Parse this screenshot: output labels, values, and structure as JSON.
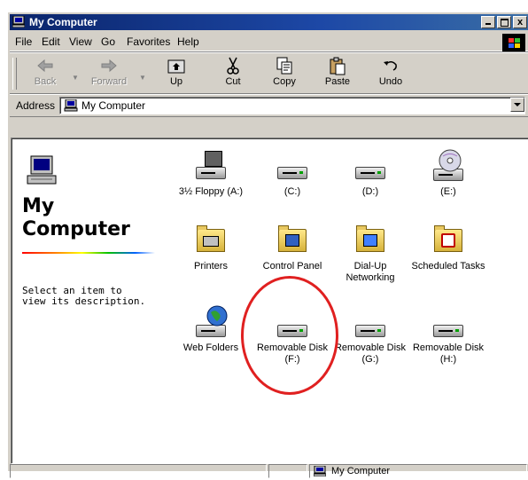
{
  "window": {
    "title": "My Computer",
    "close_glyph": "x"
  },
  "menu": {
    "items": [
      {
        "label": "File"
      },
      {
        "label": "Edit"
      },
      {
        "label": "View"
      },
      {
        "label": "Go"
      },
      {
        "label": "Favorites"
      },
      {
        "label": "Help"
      }
    ]
  },
  "toolbar": {
    "back": "Back",
    "forward": "Forward",
    "up": "Up",
    "cut": "Cut",
    "copy": "Copy",
    "paste": "Paste",
    "undo": "Undo"
  },
  "address": {
    "label": "Address",
    "value": "My Computer"
  },
  "left_panel": {
    "title_line1": "My",
    "title_line2": "Computer",
    "description": "Select an item to view its description."
  },
  "items": [
    {
      "label": "3½ Floppy (A:)",
      "icon": "floppy-drive-icon"
    },
    {
      "label": "(C:)",
      "icon": "hard-drive-icon"
    },
    {
      "label": "(D:)",
      "icon": "hard-drive-icon"
    },
    {
      "label": "(E:)",
      "icon": "cd-drive-icon"
    },
    {
      "label": "Printers",
      "icon": "printers-folder-icon"
    },
    {
      "label": "Control Panel",
      "icon": "control-panel-folder-icon"
    },
    {
      "label": "Dial-Up Networking",
      "icon": "dialup-folder-icon"
    },
    {
      "label": "Scheduled Tasks",
      "icon": "scheduled-tasks-folder-icon"
    },
    {
      "label": "Web Folders",
      "icon": "web-folders-icon"
    },
    {
      "label": "Removable Disk (F:)",
      "icon": "removable-disk-icon"
    },
    {
      "label": "Removable Disk (G:)",
      "icon": "removable-disk-icon"
    },
    {
      "label": "Removable Disk (H:)",
      "icon": "removable-disk-icon"
    }
  ],
  "status": {
    "location": "My Computer"
  },
  "colors": {
    "titlebar": "#0a246a",
    "face": "#d4d0c8",
    "highlight_circle": "#e02020"
  }
}
